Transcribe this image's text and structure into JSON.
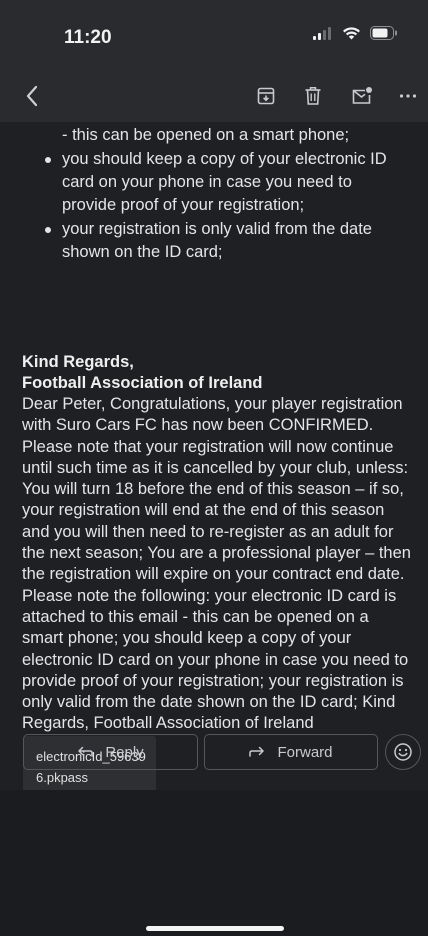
{
  "status": {
    "time": "11:20"
  },
  "toolbar": {
    "back_icon": "chevron-left-icon",
    "archive_icon": "archive-icon",
    "delete_icon": "trash-icon",
    "mark_unread_icon": "mark-unread-icon",
    "more_icon": "more-horizontal-icon"
  },
  "email": {
    "bullet_partial": "- this can be opened on a smart phone;",
    "bullets": [
      "you should keep a copy of your electronic ID card on your phone in case you need to provide proof of your registration;",
      "your registration is only valid from the date shown on the ID card;"
    ],
    "signoff_line1": "Kind Regards,",
    "signoff_line2": "Football Association of Ireland",
    "body": "Dear Peter, Congratulations, your player registration with Suro Cars FC has now been CONFIRMED. Please note that your registration will now continue until such time as it is cancelled by your club, unless: You will turn 18 before the end of this season – if so, your registration will end at the end of this season and you will then need to re-register as an adult for the next season; You are a professional player – then the registration will expire on your contract end date. Please note the following: your electronic ID card is attached to this email - this can be opened on a smart phone; you should keep a copy of your electronic ID card on your phone in case you need to provide proof of your registration; your registration is only valid from the date shown on the ID card; Kind Regards, Football Association of Ireland"
  },
  "attachment": {
    "filename": "electronicId_596396.pkpass",
    "type": "pkpass"
  },
  "actions": {
    "reply_label": "Reply",
    "forward_label": "Forward"
  }
}
